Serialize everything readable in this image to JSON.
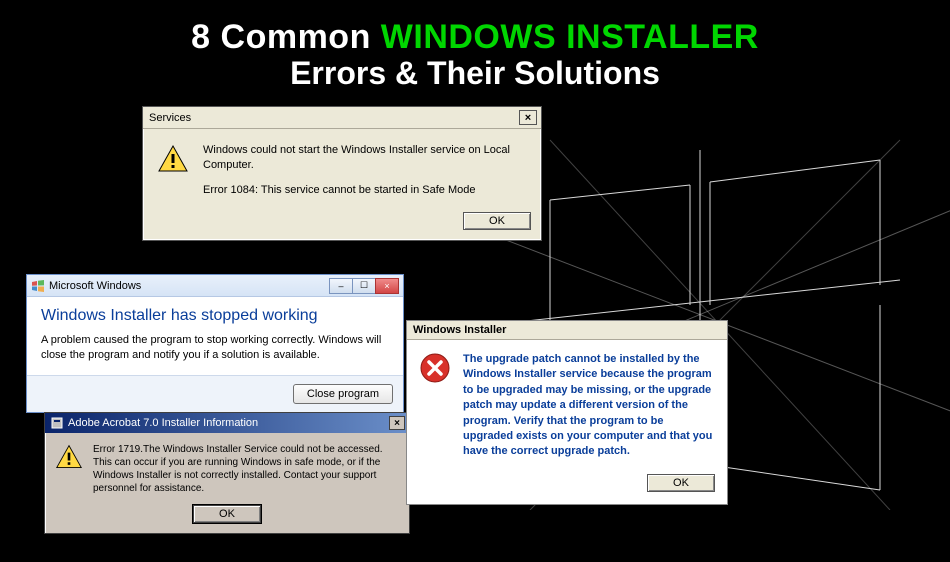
{
  "title": {
    "line1_pre": "8 Common ",
    "line1_highlight": "WINDOWS INSTALLER",
    "line2": "Errors & Their Solutions"
  },
  "dialog1": {
    "title": "Services",
    "message_line1": "Windows could not start the Windows Installer service on Local Computer.",
    "message_line2": "Error 1084: This service cannot be started in Safe Mode",
    "ok": "OK",
    "close_glyph": "×"
  },
  "dialog2": {
    "title": "Microsoft Windows",
    "header": "Windows Installer has stopped working",
    "desc": "A problem caused the program to stop working correctly. Windows will close the program and notify you if a solution is available.",
    "close_btn": "Close program",
    "min_glyph": "–",
    "max_glyph": "☐",
    "x_glyph": "×"
  },
  "dialog3": {
    "title": "Adobe Acrobat 7.0 Installer Information",
    "message": "Error 1719.The Windows Installer Service could not be accessed. This can occur if you are running Windows in safe mode, or if the Windows Installer is not correctly installed. Contact your support personnel for assistance.",
    "ok": "OK",
    "close_glyph": "×"
  },
  "dialog4": {
    "title": "Windows Installer",
    "message": "The upgrade patch cannot be installed by the Windows Installer service because the program to be upgraded may be missing, or the upgrade patch may update a different version of the program. Verify that the program to be upgraded exists on your computer and that you have the correct upgrade patch.",
    "ok": "OK"
  }
}
